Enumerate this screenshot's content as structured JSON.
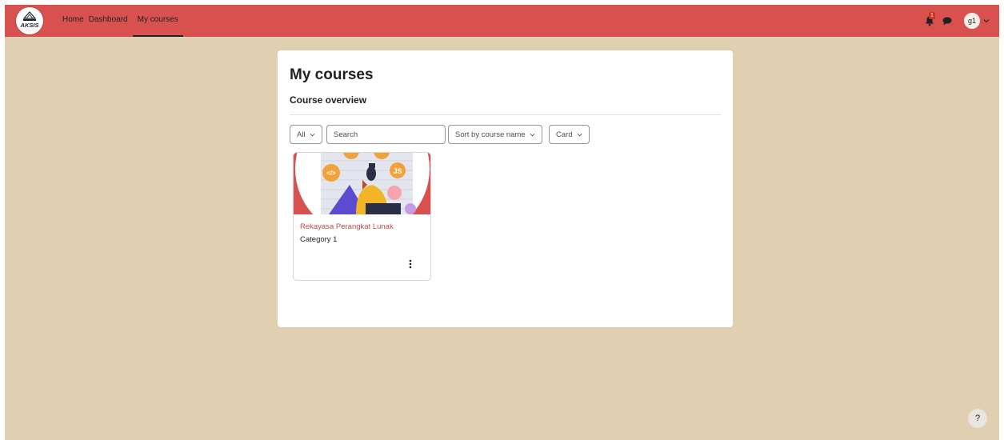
{
  "brand": {
    "logo_text": "AKSIS"
  },
  "nav": {
    "links": [
      {
        "label": "Home"
      },
      {
        "label": "Dashboard"
      },
      {
        "label": "My courses"
      }
    ],
    "notifications_count": "1",
    "user_initials": "g1"
  },
  "page": {
    "title": "My courses",
    "section_title": "Course overview"
  },
  "filters": {
    "grouping": "All",
    "search_placeholder": "Search",
    "sort": "Sort by course name",
    "view": "Card"
  },
  "courses": [
    {
      "name": "Rekayasa Perangkat Lunak",
      "category": "Category 1"
    }
  ],
  "help": {
    "label": "?"
  },
  "colors": {
    "navbar": "#d9514e",
    "background": "#e1cfb1",
    "course_link": "#c24b46"
  }
}
